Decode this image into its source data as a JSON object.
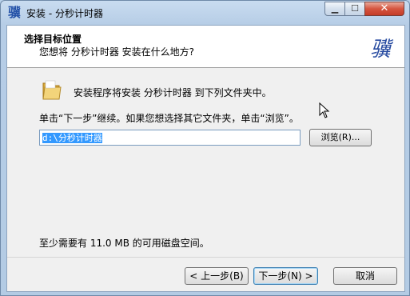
{
  "window": {
    "title": "安装 - 分秒计时器",
    "app_icon_glyph": "骥",
    "controls": {
      "minimize": "▁",
      "maximize": "☐",
      "close": "✕"
    }
  },
  "header": {
    "title": "选择目标位置",
    "subtitle": "您想将 分秒计时器 安装在什么地方?",
    "logo_glyph": "骥"
  },
  "body": {
    "install_text": "安装程序将安装 分秒计时器 到下列文件夹中。",
    "hint_text": "单击“下一步”继续。如果您想选择其它文件夹，单击“浏览”。",
    "path_value": "d:\\分秒计时器",
    "browse_label": "浏览(R)...",
    "space_text": "至少需要有 11.0 MB 的可用磁盘空间。"
  },
  "footer": {
    "back_label": "< 上一步(B)",
    "next_label": "下一步(N) >",
    "cancel_label": "取消"
  },
  "colors": {
    "accent": "#3399ff",
    "logo": "#264aa0"
  },
  "icons": {
    "folder": "folder-icon",
    "cursor": "arrow-cursor-icon"
  }
}
